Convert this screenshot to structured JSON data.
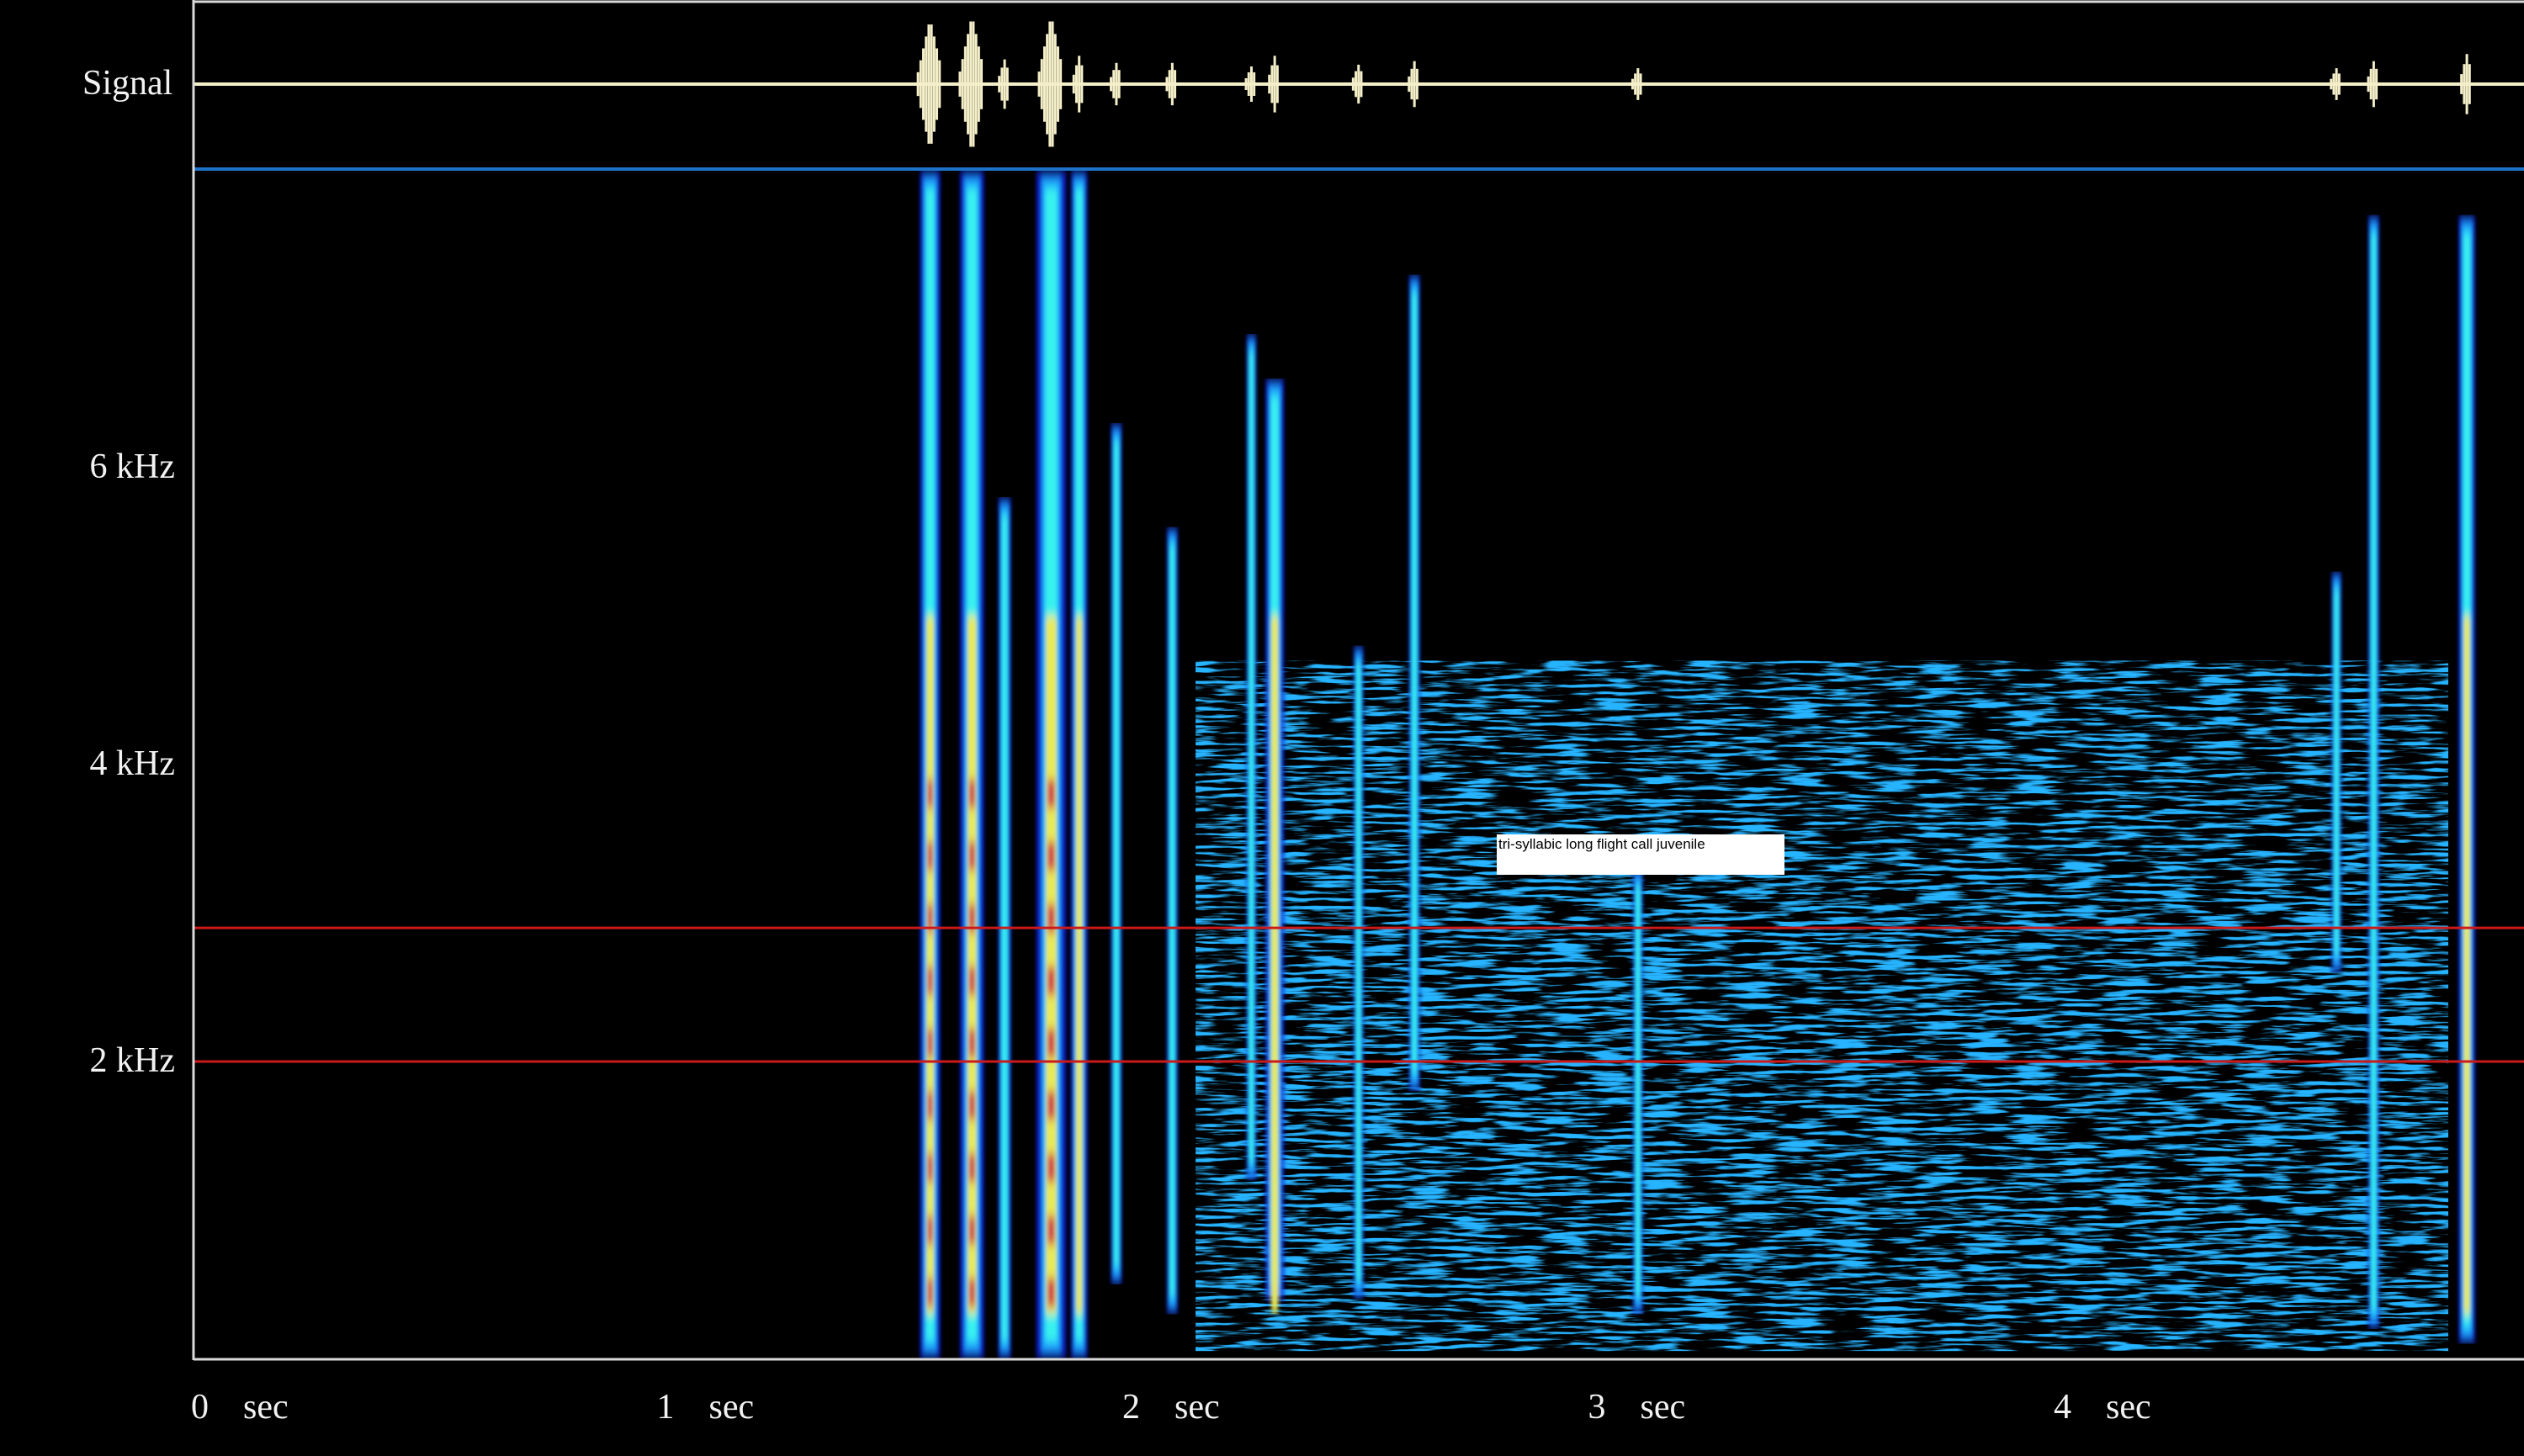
{
  "chart_data": {
    "type": "heatmap",
    "title": "",
    "signal_label": "Signal",
    "x_unit": "sec",
    "xlim": [
      0,
      5.0
    ],
    "x_ticks": [
      {
        "value": 0,
        "label": "0"
      },
      {
        "value": 1,
        "label": "1"
      },
      {
        "value": 2,
        "label": "2"
      },
      {
        "value": 3,
        "label": "3"
      },
      {
        "value": 4,
        "label": "4"
      }
    ],
    "y_unit": "kHz",
    "ylim": [
      0,
      8.0
    ],
    "y_ticks": [
      {
        "value": 2,
        "label": "2 kHz"
      },
      {
        "value": 4,
        "label": "4 kHz"
      },
      {
        "value": 6,
        "label": "6 kHz"
      }
    ],
    "reference_lines_khz": [
      2.0,
      2.9
    ],
    "colormap": [
      "#000000",
      "#0a1fd6",
      "#1aa3ff",
      "#38f0ee",
      "#e9e955",
      "#d05050"
    ],
    "colors": {
      "signal_trace": "#f4efc8",
      "divider": "#1e72c8",
      "reference_line": "#cc1a1a",
      "frame": "#d9d9d9"
    },
    "annotation": {
      "text": "tri-syllabic long flight call juvenile",
      "x": 2.8,
      "y_khz": 3.4
    },
    "calls": [
      {
        "t": 1.58,
        "w": 0.022,
        "fmin": 0.0,
        "fmax": 8.0,
        "i": 0.95
      },
      {
        "t": 1.67,
        "w": 0.026,
        "fmin": 0.0,
        "fmax": 8.0,
        "i": 1.0
      },
      {
        "t": 1.74,
        "w": 0.014,
        "fmin": 0.0,
        "fmax": 5.8,
        "i": 0.7
      },
      {
        "t": 1.84,
        "w": 0.032,
        "fmin": 0.0,
        "fmax": 8.0,
        "i": 1.0
      },
      {
        "t": 1.9,
        "w": 0.018,
        "fmin": 0.0,
        "fmax": 8.0,
        "i": 0.8
      },
      {
        "t": 1.98,
        "w": 0.012,
        "fmin": 0.5,
        "fmax": 6.3,
        "i": 0.6
      },
      {
        "t": 2.1,
        "w": 0.012,
        "fmin": 0.3,
        "fmax": 5.6,
        "i": 0.6
      },
      {
        "t": 2.27,
        "w": 0.01,
        "fmin": 1.2,
        "fmax": 6.9,
        "i": 0.5
      },
      {
        "t": 2.32,
        "w": 0.02,
        "fmin": 0.4,
        "fmax": 6.6,
        "i": 0.8
      },
      {
        "t": 2.5,
        "w": 0.01,
        "fmin": 0.4,
        "fmax": 4.8,
        "i": 0.55
      },
      {
        "t": 2.62,
        "w": 0.012,
        "fmin": 1.8,
        "fmax": 7.3,
        "i": 0.65
      },
      {
        "t": 3.1,
        "w": 0.01,
        "fmin": 0.3,
        "fmax": 3.3,
        "i": 0.45
      },
      {
        "t": 4.6,
        "w": 0.008,
        "fmin": 2.6,
        "fmax": 5.3,
        "i": 0.45
      },
      {
        "t": 4.68,
        "w": 0.012,
        "fmin": 0.2,
        "fmax": 7.7,
        "i": 0.65
      },
      {
        "t": 4.88,
        "w": 0.018,
        "fmin": 0.1,
        "fmax": 7.7,
        "i": 0.85
      }
    ]
  }
}
